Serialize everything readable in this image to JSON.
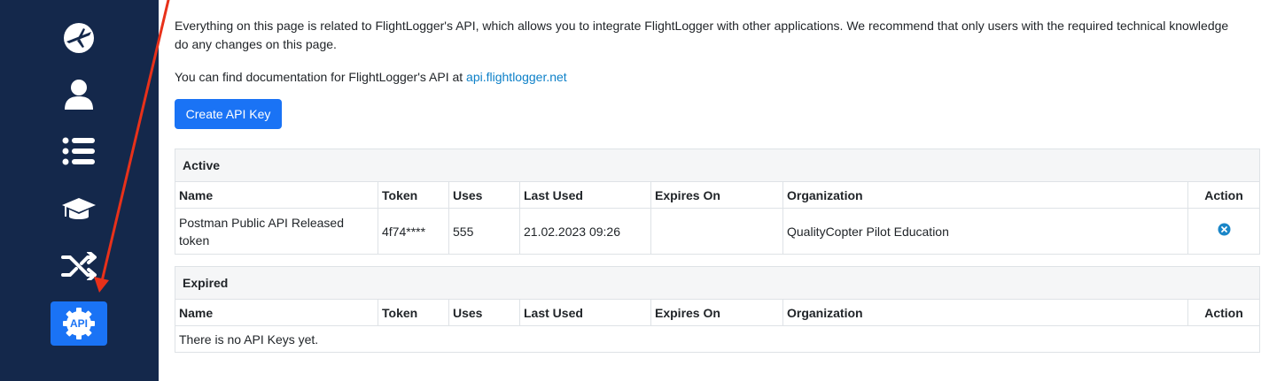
{
  "sidebar": {
    "items": [
      {
        "icon": "plane-logo-icon"
      },
      {
        "icon": "user-icon"
      },
      {
        "icon": "list-icon"
      },
      {
        "icon": "graduation-cap-icon"
      },
      {
        "icon": "shuffle-icon"
      },
      {
        "icon": "api-gear-icon",
        "label": "API",
        "active": true
      }
    ]
  },
  "intro_text": "Everything on this page is related to FlightLogger's API, which allows you to integrate FlightLogger with other applications. We recommend that only users with the required technical knowledge do any changes on this page.",
  "docs": {
    "prefix": "You can find documentation for FlightLogger's API at ",
    "link_text": "api.flightlogger.net"
  },
  "create_button_label": "Create API Key",
  "columns": [
    "Name",
    "Token",
    "Uses",
    "Last Used",
    "Expires On",
    "Organization",
    "Action"
  ],
  "active": {
    "title": "Active",
    "rows": [
      {
        "name": "Postman Public API Released token",
        "token": "4f74****",
        "uses": "555",
        "last_used": "21.02.2023 09:26",
        "expires_on": "",
        "organization": "QualityCopter Pilot Education",
        "action_icon": "remove-circle-icon"
      }
    ]
  },
  "expired": {
    "title": "Expired",
    "empty_text": "There is no API Keys yet."
  },
  "colors": {
    "sidebar_bg": "#14284b",
    "accent": "#1a73f5",
    "link": "#0d80c8",
    "annotation_arrow": "#e8311a"
  }
}
